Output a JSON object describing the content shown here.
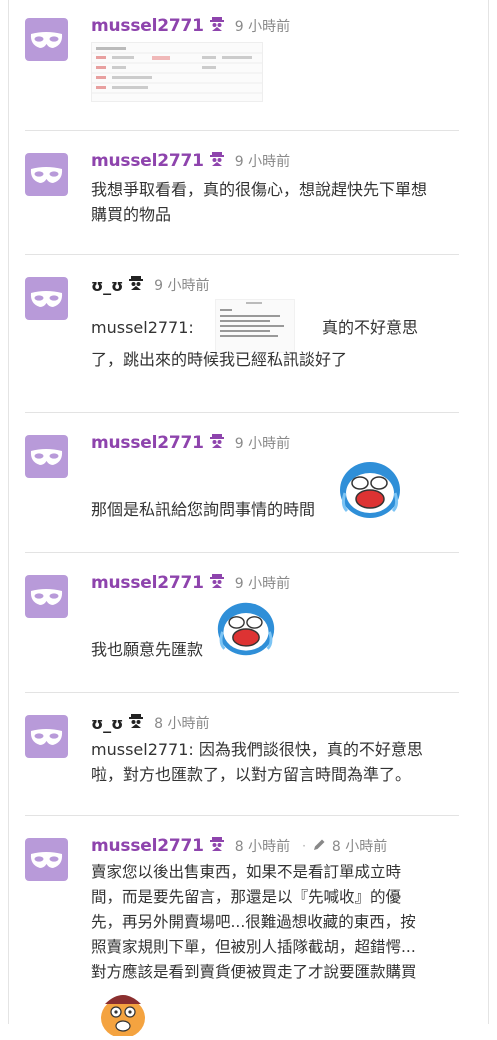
{
  "comments": [
    {
      "user": "mussel2771",
      "time": "9 小時前",
      "line1": "",
      "line2": ""
    },
    {
      "user": "mussel2771",
      "time": "9 小時前",
      "line1": "我想爭取看看，真的很傷心，想說趕快先下單想",
      "line2": "購買的物品"
    },
    {
      "user": "ʊ_ʊ",
      "time": "9 小時前",
      "quote_prefix": "mussel2771:",
      "quote_after": "真的不好意思",
      "line2": "了，跳出來的時候我已經私訊談好了"
    },
    {
      "user": "mussel2771",
      "time": "9 小時前",
      "line1": "那個是私訊給您詢問事情的時間"
    },
    {
      "user": "mussel2771",
      "time": "9 小時前",
      "line1": "我也願意先匯款"
    },
    {
      "user": "ʊ_ʊ",
      "time": "8 小時前",
      "line1": "mussel2771: 因為我們談很快，真的不好意思",
      "line2": "啦，對方也匯款了，以對方留言時間為準了。"
    },
    {
      "user": "mussel2771",
      "time": "8 小時前",
      "edited_time": "8 小時前",
      "lines": [
        "賣家您以後出售東西，如果不是看訂單成立時",
        "間，而是要先留言，那還是以『先喊收』的優",
        "先，再另外開賣場吧...很難過想收藏的東西，按",
        "照賣家規則下單，但被別人插隊截胡，超錯愕...",
        "對方應該是看到賣貨便被買走了才說要匯款購買"
      ]
    }
  ],
  "colors": {
    "username": "#8e44ad",
    "avatar_bg": "#b89ad9",
    "time": "#8a8a8a",
    "divider": "#e3e3e3"
  },
  "icons": {
    "avatar": "mask-icon",
    "badge_purple": "spy-badge-icon",
    "badge_black": "spy-badge-icon",
    "edit": "pencil-icon"
  }
}
